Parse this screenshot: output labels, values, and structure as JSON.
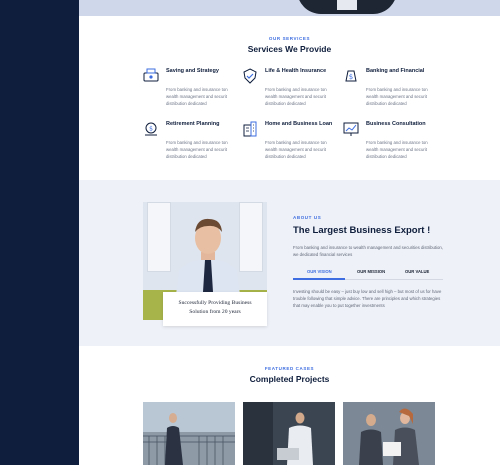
{
  "services": {
    "eyebrow": "OUR SERVICES",
    "title": "Services We Provide",
    "items": [
      {
        "icon": "savings-icon",
        "title": "Saving and Strategy",
        "desc": "From banking and  insurance ton wealth management and securit distribution dedicated"
      },
      {
        "icon": "insurance-icon",
        "title": "Life & Health Insurance",
        "desc": "From banking and  insurance ton wealth management and securit distribution dedicated"
      },
      {
        "icon": "banking-icon",
        "title": "Banking and Financial",
        "desc": "From banking and  insurance ton wealth management and securit distribution dedicated"
      },
      {
        "icon": "retirement-icon",
        "title": "Retirement Planning",
        "desc": "From banking and  insurance ton wealth management and securit distribution dedicated"
      },
      {
        "icon": "building-icon",
        "title": "Home and Business Loan",
        "desc": "From banking and  insurance ton wealth management and securit distribution dedicated"
      },
      {
        "icon": "presentation-icon",
        "title": "Business Consultation",
        "desc": "From banking and  insurance ton wealth management and securit distribution dedicated"
      }
    ]
  },
  "about": {
    "eyebrow": "ABOUT US",
    "title": "The Largest Business Export !",
    "intro": "From banking and  insurance to wealth management and securities distribution, we dedicated financial services",
    "tabs": [
      "OUR VISION",
      "OUR MISSION",
      "OUR VALUE"
    ],
    "active_tab": "OUR VISION",
    "body": "Investing should be easy – just buy low and sell high – but most of us for have trouble following that simple advice. There are principles and which strategies that may enable you to put together investments",
    "caption_line1": "Successfully Providing Business",
    "caption_line2": "Solution from 20 years"
  },
  "projects": {
    "eyebrow": "FEATURED CASES",
    "title": "Completed Projects"
  },
  "colors": {
    "sidebar": "#0f1e3c",
    "accent": "#3d6de0",
    "heading": "#0f1e3c",
    "section_bg": "#eef1f7"
  }
}
